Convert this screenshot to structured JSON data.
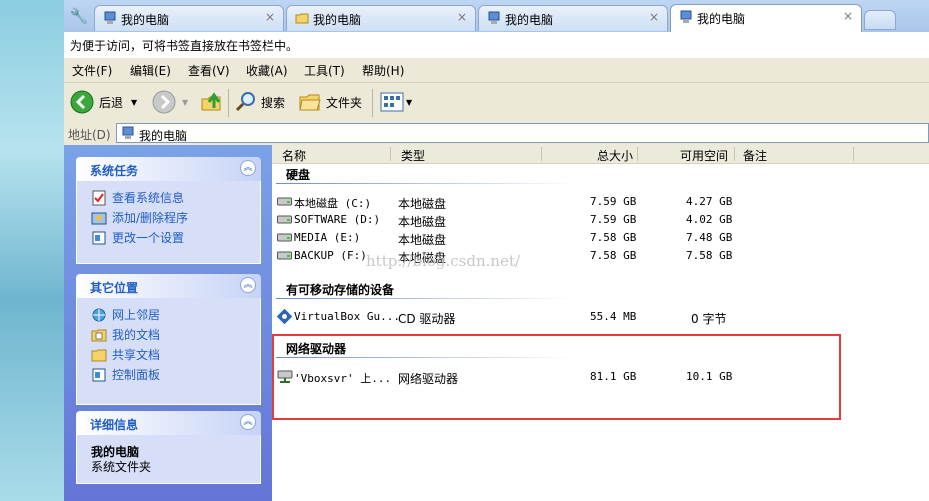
{
  "tabs": [
    {
      "label": "我的电脑",
      "icon": "computer-icon",
      "active": false,
      "close": "×"
    },
    {
      "label": "我的电脑",
      "icon": "folder-icon",
      "active": false,
      "close": "×"
    },
    {
      "label": "我的电脑",
      "icon": "computer-icon",
      "active": false,
      "close": "×"
    },
    {
      "label": "我的电脑",
      "icon": "computer-icon",
      "active": true,
      "close": "×"
    }
  ],
  "bookmark_hint": "为便于访问，可将书签直接放在书签栏中。",
  "menu": [
    "文件(F)",
    "编辑(E)",
    "查看(V)",
    "收藏(A)",
    "工具(T)",
    "帮助(H)"
  ],
  "toolbar": {
    "back": "后退",
    "search": "搜索",
    "folders": "文件夹"
  },
  "address": {
    "label": "地址(D)",
    "value": "我的电脑"
  },
  "panels": {
    "system_tasks": {
      "title": "系统任务",
      "items": [
        "查看系统信息",
        "添加/删除程序",
        "更改一个设置"
      ]
    },
    "other_places": {
      "title": "其它位置",
      "items": [
        "网上邻居",
        "我的文档",
        "共享文档",
        "控制面板"
      ]
    },
    "details": {
      "title": "详细信息",
      "name": "我的电脑",
      "type": "系统文件夹"
    }
  },
  "columns": [
    "名称",
    "类型",
    "总大小",
    "可用空间",
    "备注"
  ],
  "groups": {
    "hard_disks": {
      "title": "硬盘",
      "rows": [
        {
          "name": "本地磁盘 (C:)",
          "type": "本地磁盘",
          "total": "7.59 GB",
          "free": "4.27 GB"
        },
        {
          "name": "SOFTWARE (D:)",
          "type": "本地磁盘",
          "total": "7.59 GB",
          "free": "4.02 GB"
        },
        {
          "name": "MEDIA (E:)",
          "type": "本地磁盘",
          "total": "7.58 GB",
          "free": "7.48 GB"
        },
        {
          "name": "BACKUP (F:)",
          "type": "本地磁盘",
          "total": "7.58 GB",
          "free": "7.58 GB"
        }
      ]
    },
    "removable": {
      "title": "有可移动存储的设备",
      "rows": [
        {
          "name": "VirtualBox Gu...",
          "type": "CD 驱动器",
          "total": "55.4 MB",
          "free": "0 字节"
        }
      ]
    },
    "network": {
      "title": "网络驱动器",
      "rows": [
        {
          "name": "'Vboxsvr' 上...",
          "type": "网络驱动器",
          "total": "81.1 GB",
          "free": "10.1 GB"
        }
      ]
    }
  },
  "watermark": "http://blog.csdn.net/",
  "colors": {
    "accent": "#215dc6",
    "highlight_box": "#e53b3b",
    "sidebar": "#7ba2e7"
  }
}
